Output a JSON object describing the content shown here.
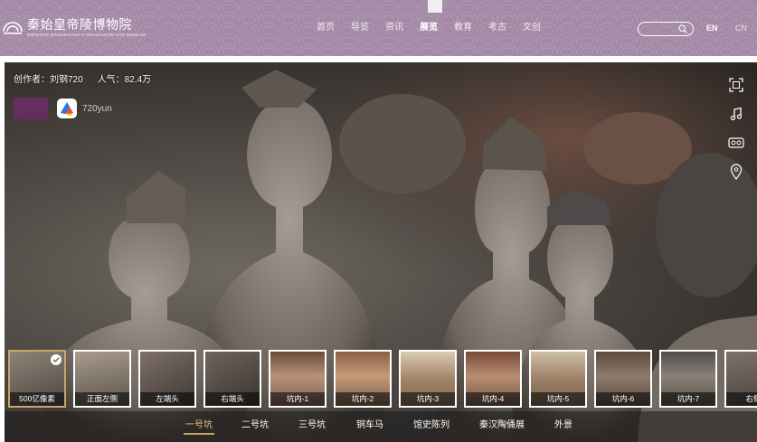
{
  "header": {
    "logo_cn": "秦始皇帝陵博物院",
    "logo_en": "EMPEROR QINSHIHUANG'S MAUSOLEUM SITE MUSEUM",
    "nav": [
      {
        "label": "首页"
      },
      {
        "label": "导览"
      },
      {
        "label": "资讯"
      },
      {
        "label": "展览",
        "active": true
      },
      {
        "label": "教育"
      },
      {
        "label": "考古"
      },
      {
        "label": "文创"
      }
    ],
    "search": {
      "placeholder": ""
    },
    "lang_en": "EN",
    "lang_cn": "CN"
  },
  "viewer": {
    "creator": "创作者：刘钢720",
    "popularity": "人气：82.4万",
    "brand_text": "720yun",
    "tools": [
      "fullscreen-icon",
      "music-note-icon",
      "vr-glasses-icon",
      "location-pin-icon"
    ],
    "thumbnails": [
      {
        "label": "500亿像素",
        "selected": true
      },
      {
        "label": "正面左侧"
      },
      {
        "label": "左端头"
      },
      {
        "label": "右端头"
      },
      {
        "label": "坑内-1"
      },
      {
        "label": "坑内-2"
      },
      {
        "label": "坑内-3"
      },
      {
        "label": "坑内-4"
      },
      {
        "label": "坑内-5"
      },
      {
        "label": "坑内-6"
      },
      {
        "label": "坑内-7"
      },
      {
        "label": "右侧"
      }
    ],
    "scene_tabs": [
      {
        "label": "一号坑",
        "active": true
      },
      {
        "label": "二号坑"
      },
      {
        "label": "三号坑"
      },
      {
        "label": "铜车马"
      },
      {
        "label": "馆史陈列"
      },
      {
        "label": "秦汉陶俑展"
      },
      {
        "label": "外景"
      }
    ]
  },
  "colors": {
    "header_bg": "#a48aa6",
    "accent_gold": "#c9a66b",
    "active_tab_text": "#e6c483"
  }
}
